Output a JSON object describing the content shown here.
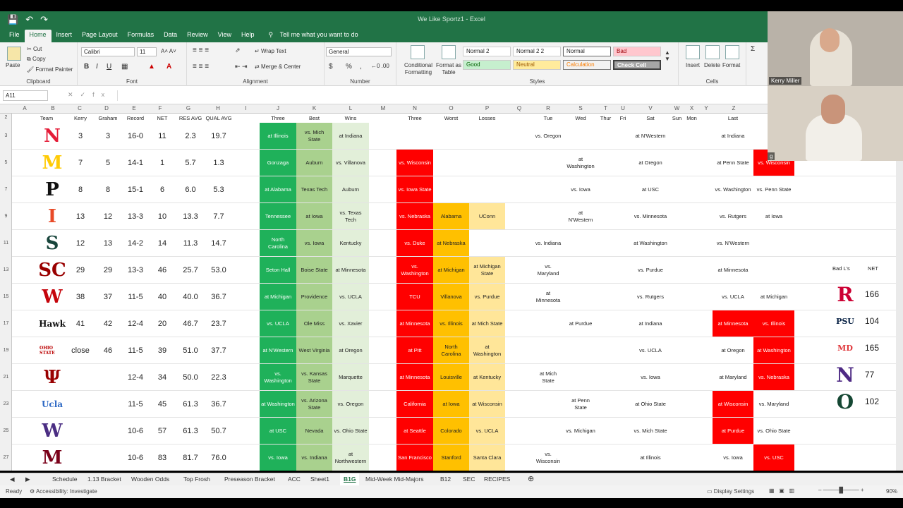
{
  "window": {
    "title": "We Like Sportz1 - Excel"
  },
  "menu": [
    "File",
    "Home",
    "Insert",
    "Page Layout",
    "Formulas",
    "Data",
    "Review",
    "View",
    "Help"
  ],
  "tell_me": "Tell me what you want to do",
  "ribbon": {
    "clipboard": {
      "paste": "Paste",
      "cut": "Cut",
      "copy": "Copy",
      "painter": "Format Painter",
      "label": "Clipboard"
    },
    "font": {
      "name": "Calibri",
      "size": "11",
      "bold": "B",
      "italic": "I",
      "underline": "U",
      "label": "Font"
    },
    "alignment": {
      "wrap": "Wrap Text",
      "merge": "Merge & Center",
      "label": "Alignment"
    },
    "number": {
      "format": "General",
      "currency": "$",
      "percent": "%",
      "comma": ",",
      "label": "Number"
    },
    "styles": {
      "conditional": "Conditional Formatting",
      "format_table": "Format as Table",
      "label": "Styles",
      "cells": [
        "Normal 2",
        "Normal 2 2",
        "Normal",
        "Bad",
        "Good",
        "Neutral",
        "Calculation",
        "Check Cell"
      ]
    },
    "cells": {
      "insert": "Insert",
      "delete": "Delete",
      "format": "Format",
      "label": "Cells"
    }
  },
  "namebox": "A11",
  "columns": [
    "A",
    "B",
    "C",
    "D",
    "E",
    "F",
    "G",
    "H",
    "I",
    "J",
    "K",
    "L",
    "M",
    "N",
    "O",
    "P",
    "Q",
    "R",
    "S",
    "T",
    "U",
    "V",
    "W",
    "X",
    "Y",
    "Z",
    "AA"
  ],
  "header_row": {
    "team": "Team",
    "kerry": "Kerry",
    "graham": "Graham",
    "record": "Record",
    "net": "NET",
    "res": "RES AVG",
    "qual": "QUAL AVG",
    "three": "Three",
    "best": "Best",
    "wins": "Wins",
    "three2": "Three",
    "worst": "Worst",
    "losses": "Losses",
    "tue": "Tue",
    "wed": "Wed",
    "thur": "Thur",
    "fri": "Fri",
    "sat": "Sat",
    "sun": "Sun",
    "mon": "Mon",
    "last": "Last"
  },
  "row_numbers": [
    "2",
    "3",
    "5",
    "7",
    "9",
    "11",
    "13",
    "15",
    "17",
    "19",
    "21",
    "23",
    "25",
    "27"
  ],
  "rows": [
    {
      "logo": "N",
      "logo_color": "#e41c38",
      "kerry": "3",
      "graham": "3",
      "record": "16-0",
      "net": "11",
      "res": "2.3",
      "qual": "19.7",
      "three": "at Illinois",
      "best": "vs. Mich State",
      "wins": "at Indiana",
      "n": "",
      "o": "",
      "p": "",
      "tue": "vs. Oregon",
      "wed": "",
      "sat": "at N'Western",
      "last": "at Indiana",
      "last2": ""
    },
    {
      "logo": "M",
      "logo_color": "#ffcb05",
      "kerry": "7",
      "graham": "5",
      "record": "14-1",
      "net": "1",
      "res": "5.7",
      "qual": "1.3",
      "three": "Gonzaga",
      "best": "Auburn",
      "wins": "vs. Villanova",
      "n": "vs. Wisconsin",
      "o": "",
      "p": "",
      "tue": "",
      "wed": "at Washington",
      "sat": "at Oregon",
      "last": "at Penn State",
      "last2": "vs. Wisconsin"
    },
    {
      "logo": "P",
      "logo_color": "#111111",
      "kerry": "8",
      "graham": "8",
      "record": "15-1",
      "net": "6",
      "res": "6.0",
      "qual": "5.3",
      "three": "at Alabama",
      "best": "Texas Tech",
      "wins": "Auburn",
      "n": "vs. Iowa State",
      "o": "",
      "p": "",
      "tue": "",
      "wed": "vs. Iowa",
      "sat": "at USC",
      "last": "vs. Washington",
      "last2": "vs. Penn State"
    },
    {
      "logo": "I",
      "logo_color": "#e84a27",
      "kerry": "13",
      "graham": "12",
      "record": "13-3",
      "net": "10",
      "res": "13.3",
      "qual": "7.7",
      "three": "Tennessee",
      "best": "at Iowa",
      "wins": "vs. Texas Tech",
      "n": "vs. Nebraska",
      "o": "Alabama",
      "p": "UConn",
      "tue": "",
      "wed": "at N'Western",
      "sat": "vs. Minnesota",
      "last": "vs. Rutgers",
      "last2": "at Iowa"
    },
    {
      "logo": "S",
      "logo_color": "#18453b",
      "kerry": "12",
      "graham": "13",
      "record": "14-2",
      "net": "14",
      "res": "11.3",
      "qual": "14.7",
      "three": "North Carolina",
      "best": "vs. Iowa",
      "wins": "Kentucky",
      "n": "vs. Duke",
      "o": "at Nebraska",
      "p": "",
      "tue": "vs. Indiana",
      "wed": "",
      "sat": "at Washington",
      "last": "vs. N'Western",
      "last2": ""
    },
    {
      "logo": "SC",
      "logo_color": "#990000",
      "kerry": "29",
      "graham": "29",
      "record": "13-3",
      "net": "46",
      "res": "25.7",
      "qual": "53.0",
      "three": "Seton Hall",
      "best": "Boise State",
      "wins": "at Minnesota",
      "n": "vs. Washington",
      "o": "at Michigan",
      "p": "at Michigan State",
      "tue": "vs. Maryland",
      "wed": "",
      "sat": "vs. Purdue",
      "last": "at Minnesota",
      "last2": ""
    },
    {
      "logo": "W",
      "logo_color": "#c5050c",
      "kerry": "38",
      "graham": "37",
      "record": "11-5",
      "net": "40",
      "res": "40.0",
      "qual": "36.7",
      "three": "at Michigan",
      "best": "Providence",
      "wins": "vs. UCLA",
      "n": "TCU",
      "o": "Villanova",
      "p": "vs. Purdue",
      "tue": "at Minnesota",
      "wed": "",
      "sat": "vs. Rutgers",
      "last": "vs. UCLA",
      "last2": "at Michigan"
    },
    {
      "logo": "Hawk",
      "logo_color": "#111111",
      "kerry": "41",
      "graham": "42",
      "record": "12-4",
      "net": "20",
      "res": "46.7",
      "qual": "23.7",
      "three": "vs. UCLA",
      "best": "Ole Miss",
      "wins": "vs. Xavier",
      "n": "at Minnesota",
      "o": "vs. Illinois",
      "p": "at Mich State",
      "tue": "",
      "wed": "at Purdue",
      "sat": "at Indiana",
      "last": "at Minnesota",
      "last2": "vs. Illinois"
    },
    {
      "logo": "OHIO STATE",
      "logo_color": "#bb0000",
      "kerry": "close",
      "graham": "46",
      "record": "11-5",
      "net": "39",
      "res": "51.0",
      "qual": "37.7",
      "three": "at N'Western",
      "best": "West Virginia",
      "wins": "at Oregon",
      "n": "at Pitt",
      "o": "North Carolina",
      "p": "at Washington",
      "tue": "",
      "wed": "",
      "sat": "vs. UCLA",
      "last": "at Oregon",
      "last2": "at Washington"
    },
    {
      "logo": "Ψ",
      "logo_color": "#990000",
      "kerry": "",
      "graham": "",
      "record": "12-4",
      "net": "34",
      "res": "50.0",
      "qual": "22.3",
      "three": "vs. Washington",
      "best": "vs. Kansas State",
      "wins": "Marquette",
      "n": "at Minnesota",
      "o": "Louisville",
      "p": "at Kentucky",
      "tue": "at Mich State",
      "wed": "",
      "sat": "vs. Iowa",
      "last": "at Maryland",
      "last2": "vs. Nebraska"
    },
    {
      "logo": "Ucla",
      "logo_color": "#2d68c4",
      "kerry": "",
      "graham": "",
      "record": "11-5",
      "net": "45",
      "res": "61.3",
      "qual": "36.7",
      "three": "at Washington",
      "best": "vs. Arizona State",
      "wins": "vs. Oregon",
      "n": "California",
      "o": "at Iowa",
      "p": "at Wisconsin",
      "tue": "",
      "wed": "at Penn State",
      "sat": "at Ohio State",
      "last": "at Wisconsin",
      "last2": "vs. Maryland"
    },
    {
      "logo": "W",
      "logo_color": "#4b2e83",
      "kerry": "",
      "graham": "",
      "record": "10-6",
      "net": "57",
      "res": "61.3",
      "qual": "50.7",
      "three": "at USC",
      "best": "Nevada",
      "wins": "vs. Ohio State",
      "n": "at Seattle",
      "o": "Colorado",
      "p": "vs. UCLA",
      "tue": "",
      "wed": "vs. Michigan",
      "sat": "vs. Mich State",
      "last": "at Purdue",
      "last2": "vs. Ohio State"
    },
    {
      "logo": "M",
      "logo_color": "#7a0019",
      "kerry": "",
      "graham": "",
      "record": "10-6",
      "net": "83",
      "res": "81.7",
      "qual": "76.0",
      "three": "vs. Iowa",
      "best": "vs. Indiana",
      "wins": "at Northwestern",
      "n": "San Francisco",
      "o": "Stanford",
      "p": "Santa Clara",
      "tue": "vs. Wisconsin",
      "wed": "",
      "sat": "at Illinois",
      "last": "vs. Iowa",
      "last2": "vs. USC"
    }
  ],
  "side_table": {
    "h1": "Bad L's",
    "h2": "NET",
    "rows": [
      {
        "logo": "R",
        "color": "#cc0033",
        "net": "166"
      },
      {
        "logo": "PSU",
        "color": "#041e42",
        "net": "104"
      },
      {
        "logo": "MD",
        "color": "#e03a3e",
        "net": "165"
      },
      {
        "logo": "N",
        "color": "#4e2a84",
        "net": "77"
      },
      {
        "logo": "O",
        "color": "#154733",
        "net": "102"
      }
    ]
  },
  "sheet_tabs": [
    "Schedule",
    "1.13 Bracket",
    "Wooden Odds",
    "Top Frosh",
    "Preseason Bracket",
    "ACC",
    "Sheet1",
    "B1G",
    "Mid-Week Mid-Majors",
    "B12",
    "SEC",
    "RECIPES"
  ],
  "active_tab": "B1G",
  "status": {
    "ready": "Ready",
    "accessibility": "Accessibility: Investigate",
    "display": "Display Settings",
    "zoom": "90%"
  },
  "video": {
    "p1": "Kerry Miller",
    "p2": "g"
  }
}
